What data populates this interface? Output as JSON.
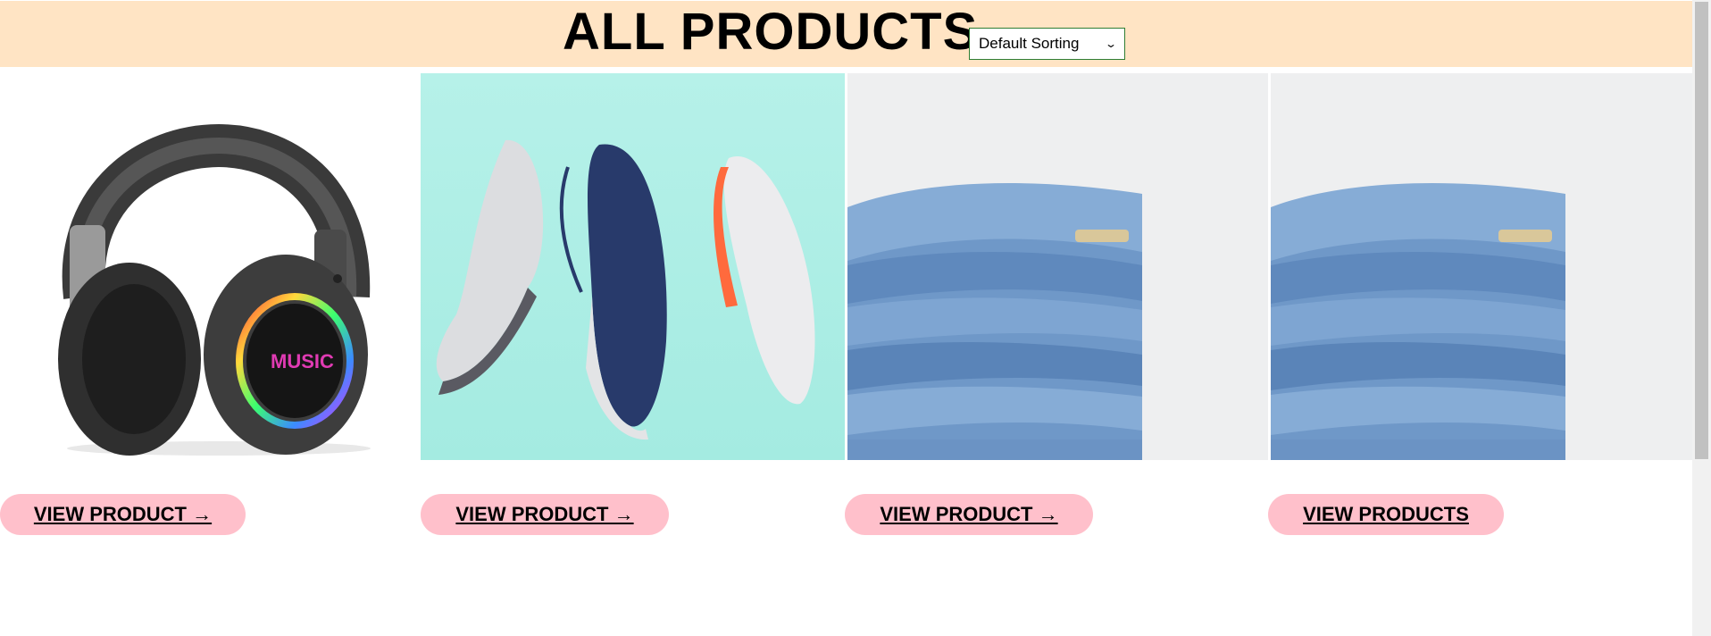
{
  "header": {
    "title": "ALL PRODUCTS",
    "sort": {
      "selected": "Default Sorting",
      "icon": "chevron-down-icon"
    }
  },
  "products": [
    {
      "name": "headphones",
      "image": "headphones-image",
      "button_label": "VIEW PRODUCT →"
    },
    {
      "name": "sneakers",
      "image": "sneakers-image",
      "button_label": "VIEW PRODUCT →"
    },
    {
      "name": "jeans",
      "image": "jeans-image",
      "button_label": "VIEW PRODUCT →"
    },
    {
      "name": "jeans",
      "image": "jeans-image",
      "button_label": "VIEW PRODUCTS"
    }
  ],
  "headphones_logo": "MUSIC",
  "colors": {
    "header_bg": "#ffe4c4",
    "button_bg": "#ffc0cb",
    "select_border": "#2e7d32"
  }
}
